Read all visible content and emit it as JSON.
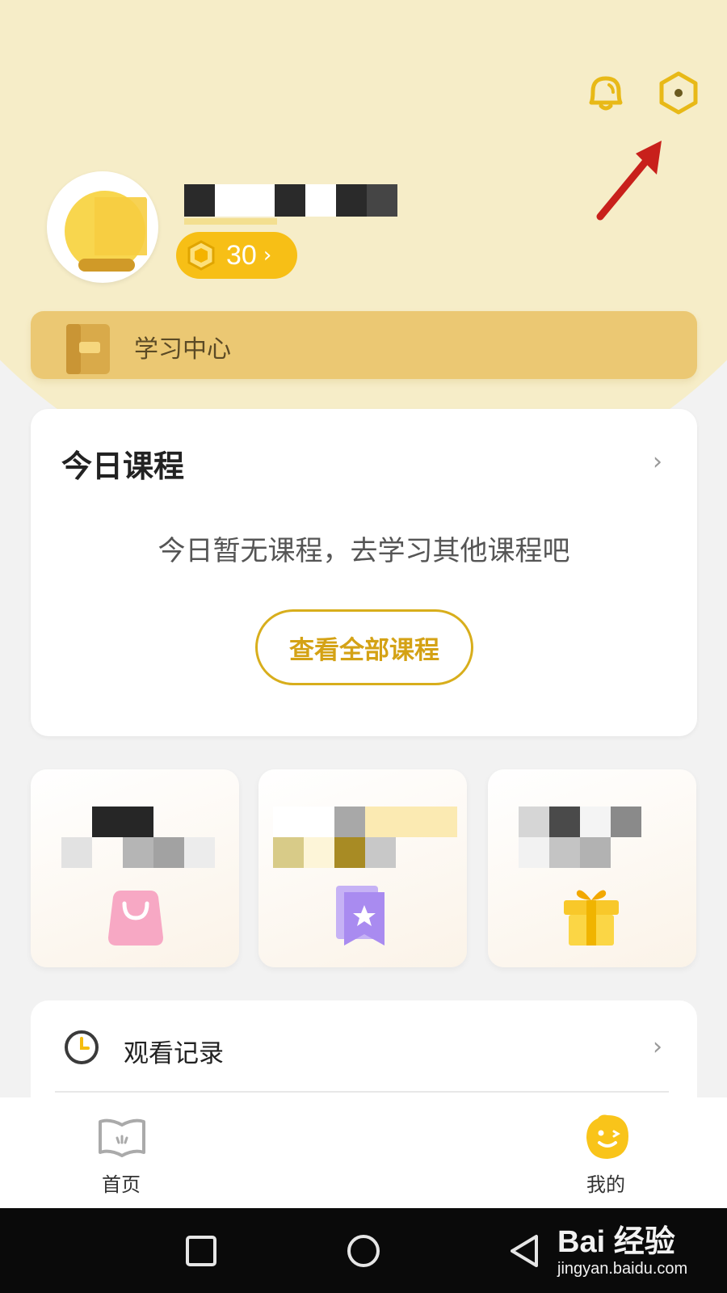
{
  "profile": {
    "coin_count": "30",
    "coin_chevron": "›"
  },
  "study_center": {
    "label": "学习中心"
  },
  "today_course": {
    "title": "今日课程",
    "chevron": "›",
    "empty_message": "今日暂无课程，去学习其他课程吧",
    "view_all_button": "查看全部课程"
  },
  "feature_tiles": [
    {
      "icon": "shopping-bag-icon",
      "color": "#f7a8c4"
    },
    {
      "icon": "bookmark-star-icon",
      "color": "#a98bf0"
    },
    {
      "icon": "gift-icon",
      "color": "#f8c82a"
    }
  ],
  "watch_history": {
    "label": "观看记录",
    "chevron": "›"
  },
  "bottom_nav": {
    "home_label": "首页",
    "mine_label": "我的"
  },
  "watermark": {
    "main": "Bai 经验",
    "sub": "jingyan.baidu.com"
  },
  "colors": {
    "accent": "#f7bf16",
    "header_bg": "#f6edc8",
    "study_bar": "#ebc873",
    "button_border": "#d8ae1c",
    "annotation_arrow": "#c8201b"
  }
}
